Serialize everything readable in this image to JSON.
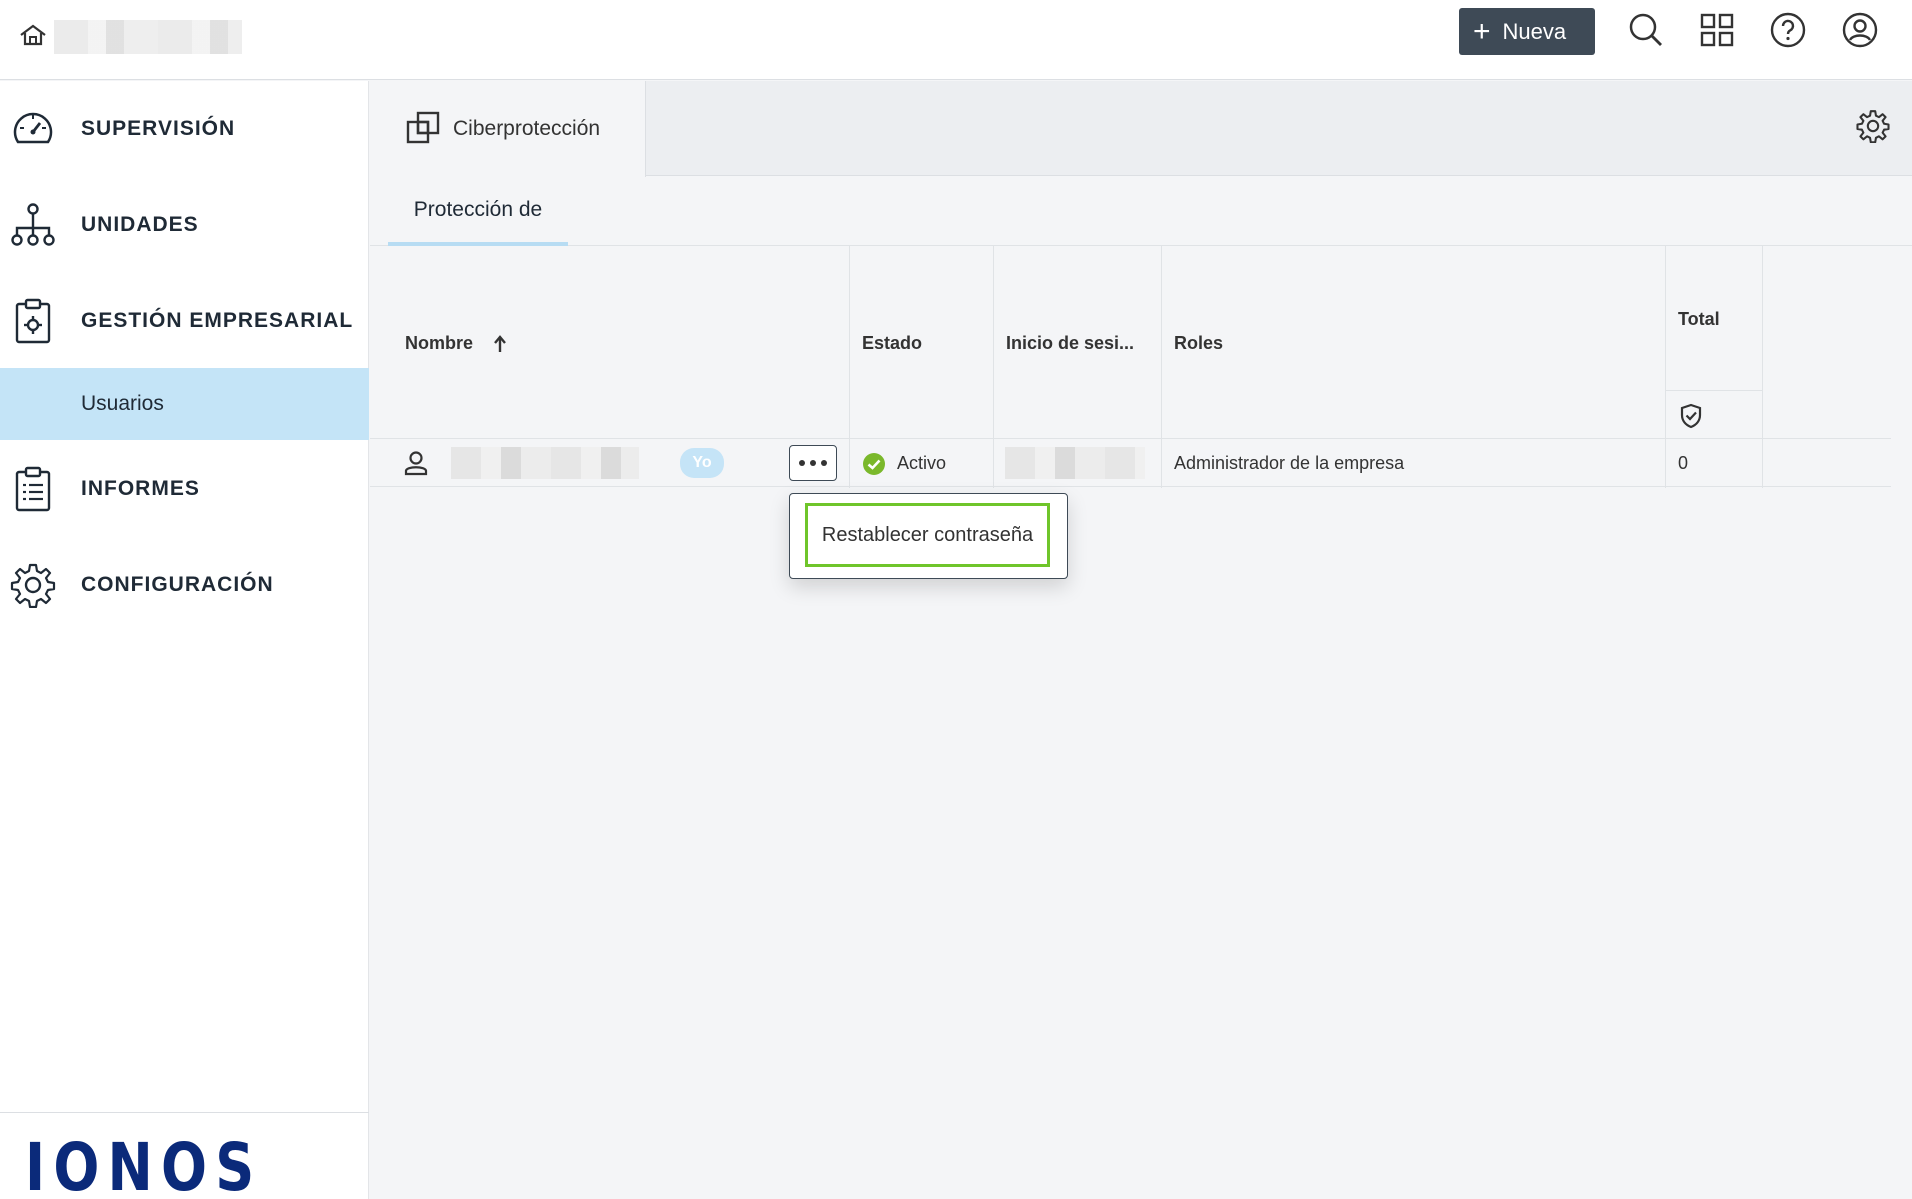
{
  "topbar": {
    "new_button": "Nueva",
    "icons": [
      "home-icon",
      "search-icon",
      "apps-grid-icon",
      "help-icon",
      "account-icon"
    ]
  },
  "sidebar": {
    "items": [
      {
        "label": "SUPERVISIÓN",
        "icon": "speedometer-icon"
      },
      {
        "label": "UNIDADES",
        "icon": "hierarchy-icon"
      },
      {
        "label": "GESTIÓN EMPRESARIAL",
        "icon": "clipboard-gear-icon"
      },
      {
        "label": "INFORMES",
        "icon": "report-icon"
      },
      {
        "label": "CONFIGURACIÓN",
        "icon": "gear-icon"
      }
    ],
    "active_subitem": "Usuarios",
    "logo": "IONOS"
  },
  "main": {
    "tab": "Ciberprotección",
    "subtab": "Protección de",
    "columns": {
      "name": "Nombre",
      "status": "Estado",
      "login": "Inicio de sesi...",
      "roles": "Roles",
      "total": "Total"
    },
    "rows": [
      {
        "badge": "Yo",
        "status": "Activo",
        "role": "Administrador de la empresa",
        "total": "0"
      }
    ],
    "menu": {
      "reset_password": "Restablecer contraseña"
    }
  },
  "colors": {
    "accent": "#3e4a56",
    "active_bg": "#c4e4f7",
    "highlight": "#6fc52a",
    "status_ok": "#7ab82b",
    "logo": "#0b2a7a"
  }
}
